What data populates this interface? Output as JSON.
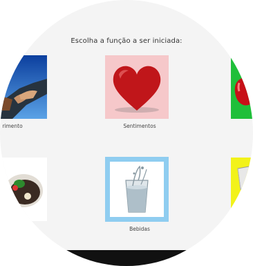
{
  "title": "Escolha a função a ser iniciada:",
  "tiles": [
    {
      "label": "rimento",
      "icon": "handshake-icon",
      "bg": "#1e5db8"
    },
    {
      "label": "Sentimentos",
      "icon": "heart-icon",
      "bg": "#f6c8ca"
    },
    {
      "label": "",
      "icon": "apple-icon",
      "bg": "#1fbf3a"
    },
    {
      "label": "",
      "icon": "food-plate-icon",
      "bg": "#ffffff"
    },
    {
      "label": "Bebidas",
      "icon": "water-glass-icon",
      "bg": "#8fcdf0"
    },
    {
      "label": "",
      "icon": "box-icon",
      "bg": "#f2f21a"
    }
  ],
  "colors": {
    "background": "#f4f4f4",
    "heart": "#c0161a",
    "heart_tile": "#f6c8ca",
    "bebidas_tile": "#8fcdf0",
    "green_tile": "#1fbf3a",
    "yellow_tile": "#f2f21a"
  }
}
